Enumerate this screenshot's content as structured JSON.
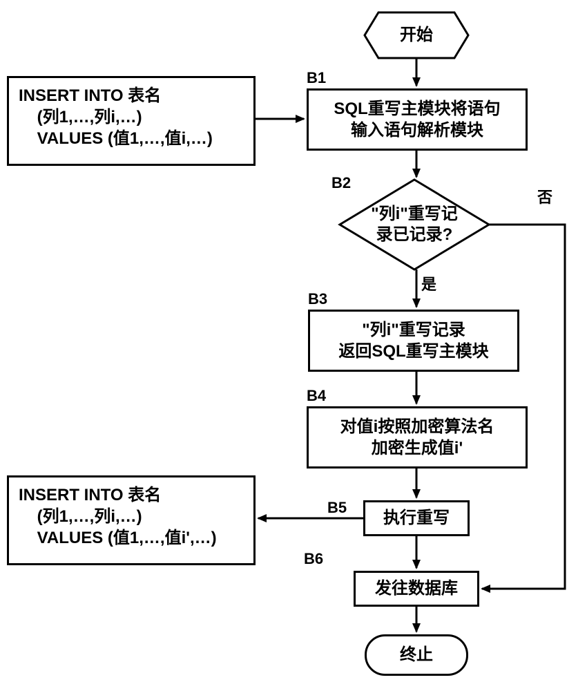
{
  "terminals": {
    "start": "开始",
    "end": "终止"
  },
  "inputs": {
    "top": "INSERT INTO 表名\n    (列1,…,列i,…)\n    VALUES (值1,…,值i,…)",
    "bottom": "INSERT INTO 表名\n    (列1,…,列i,…)\n    VALUES (值1,…,值i',…)"
  },
  "steps": {
    "b1": "SQL重写主模块将语句\n输入语句解析模块",
    "b2": "\"列i\"重写记\n录已记录?",
    "b3": "\"列i\"重写记录\n返回SQL重写主模块",
    "b4": "对值i按照加密算法名\n加密生成值i'",
    "b5": "执行重写",
    "b6": "发往数据库"
  },
  "step_labels": {
    "b1": "B1",
    "b2": "B2",
    "b3": "B3",
    "b4": "B4",
    "b5": "B5",
    "b6": "B6"
  },
  "branches": {
    "yes": "是",
    "no": "否"
  }
}
